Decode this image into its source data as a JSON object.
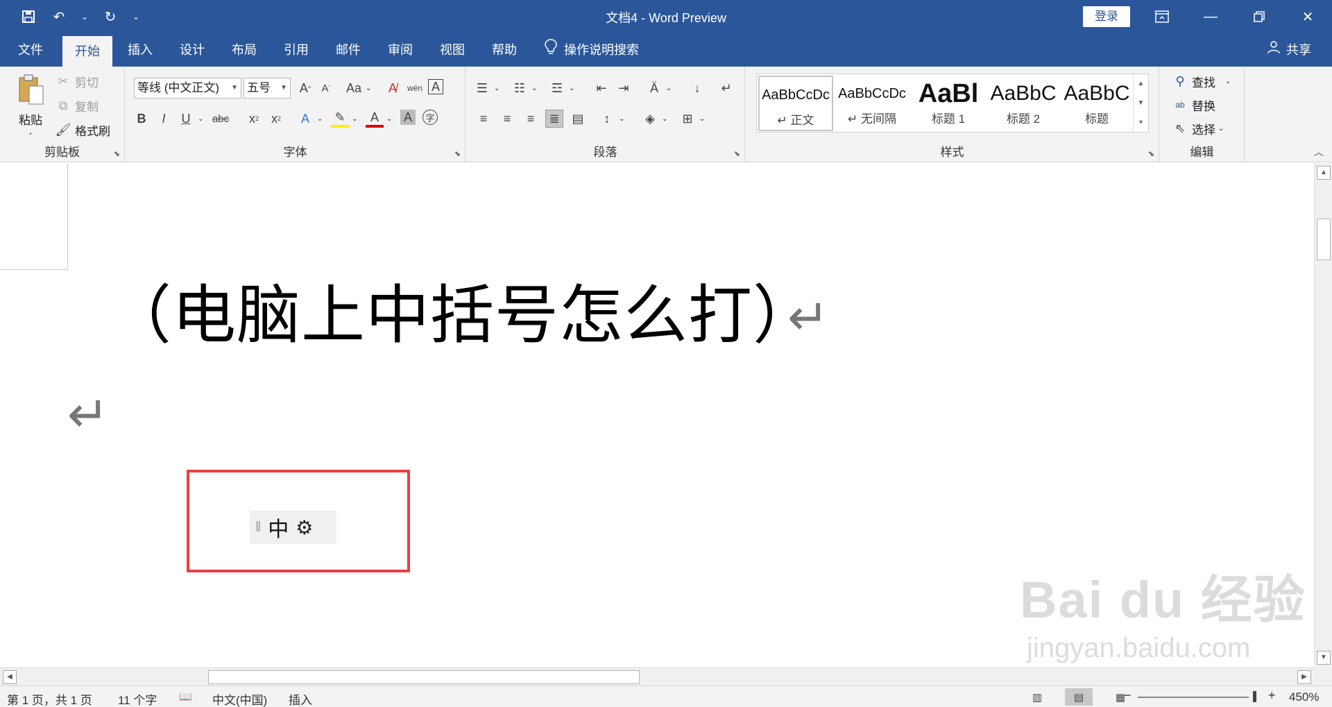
{
  "titlebar": {
    "title": "文档4  -  Word Preview",
    "login_label": "登录",
    "qat": [
      "save-icon",
      "undo-icon",
      "redo-icon",
      "customize-icon"
    ],
    "window_controls": [
      "ribbon-display-icon",
      "minimize-icon",
      "restore-icon",
      "close-icon"
    ],
    "bg_color": "#2b579a"
  },
  "tabs": [
    {
      "label": "文件"
    },
    {
      "label": "开始",
      "active": true
    },
    {
      "label": "插入"
    },
    {
      "label": "设计"
    },
    {
      "label": "布局"
    },
    {
      "label": "引用"
    },
    {
      "label": "邮件"
    },
    {
      "label": "审阅"
    },
    {
      "label": "视图"
    },
    {
      "label": "帮助"
    }
  ],
  "tell_me": "操作说明搜索",
  "share_label": "共享",
  "ribbon": {
    "clipboard": {
      "label": "剪贴板",
      "paste": "粘贴",
      "cut": "剪切",
      "copy": "复制",
      "format_painter": "格式刷"
    },
    "font": {
      "label": "字体",
      "font_name": "等线 (中文正文)",
      "font_size": "五号"
    },
    "paragraph": {
      "label": "段落"
    },
    "styles": {
      "label": "样式",
      "items": [
        {
          "sample": "AaBbCcDc",
          "name": "↵ 正文"
        },
        {
          "sample": "AaBbCcDc",
          "name": "↵ 无间隔"
        },
        {
          "sample": "AaBl",
          "name": "标题 1"
        },
        {
          "sample": "AaBbC",
          "name": "标题 2"
        },
        {
          "sample": "AaBbC",
          "name": "标题"
        }
      ]
    },
    "editing": {
      "label": "编辑",
      "find": "查找",
      "replace": "替换",
      "select": "选择"
    }
  },
  "document": {
    "heading": "（电脑上中括号怎么打）",
    "paragraph_mark": "↵"
  },
  "ime": {
    "mode": "中",
    "settings_icon": "gear-icon"
  },
  "watermark": {
    "main": "Bai du 经验",
    "sub": "jingyan.baidu.com"
  },
  "statusbar": {
    "page": "第 1 页，共 1 页",
    "words": "11 个字",
    "language": "中文(中国)",
    "mode": "插入",
    "zoom": "450%"
  },
  "colors": {
    "accent": "#2b579a",
    "highlight_box": "#e8403f"
  }
}
